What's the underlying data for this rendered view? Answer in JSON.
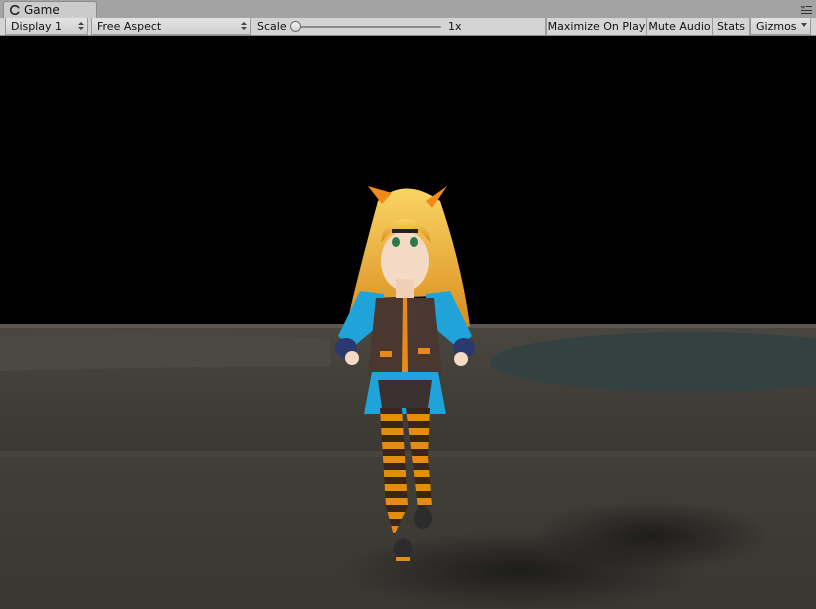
{
  "tab": {
    "title": "Game",
    "icon": "game-controller-icon",
    "menu_icon": "tab-menu-icon"
  },
  "toolbar": {
    "display": "Display 1",
    "aspect": "Free Aspect",
    "scale_label": "Scale",
    "scale_value": "1x",
    "scale_fraction": 0.0,
    "maximize_label": "Maximize On Play",
    "mute_label": "Mute Audio",
    "stats_label": "Stats",
    "gizmos_label": "Gizmos"
  },
  "colors": {
    "background": "#000000",
    "ground": "#3a3731",
    "water": "#34403f",
    "hair": "#f5b53d",
    "jacket": "#1fa3d8",
    "vest": "#4a3730",
    "stockings_orange": "#e0860f",
    "stockings_dark": "#3b2518"
  }
}
